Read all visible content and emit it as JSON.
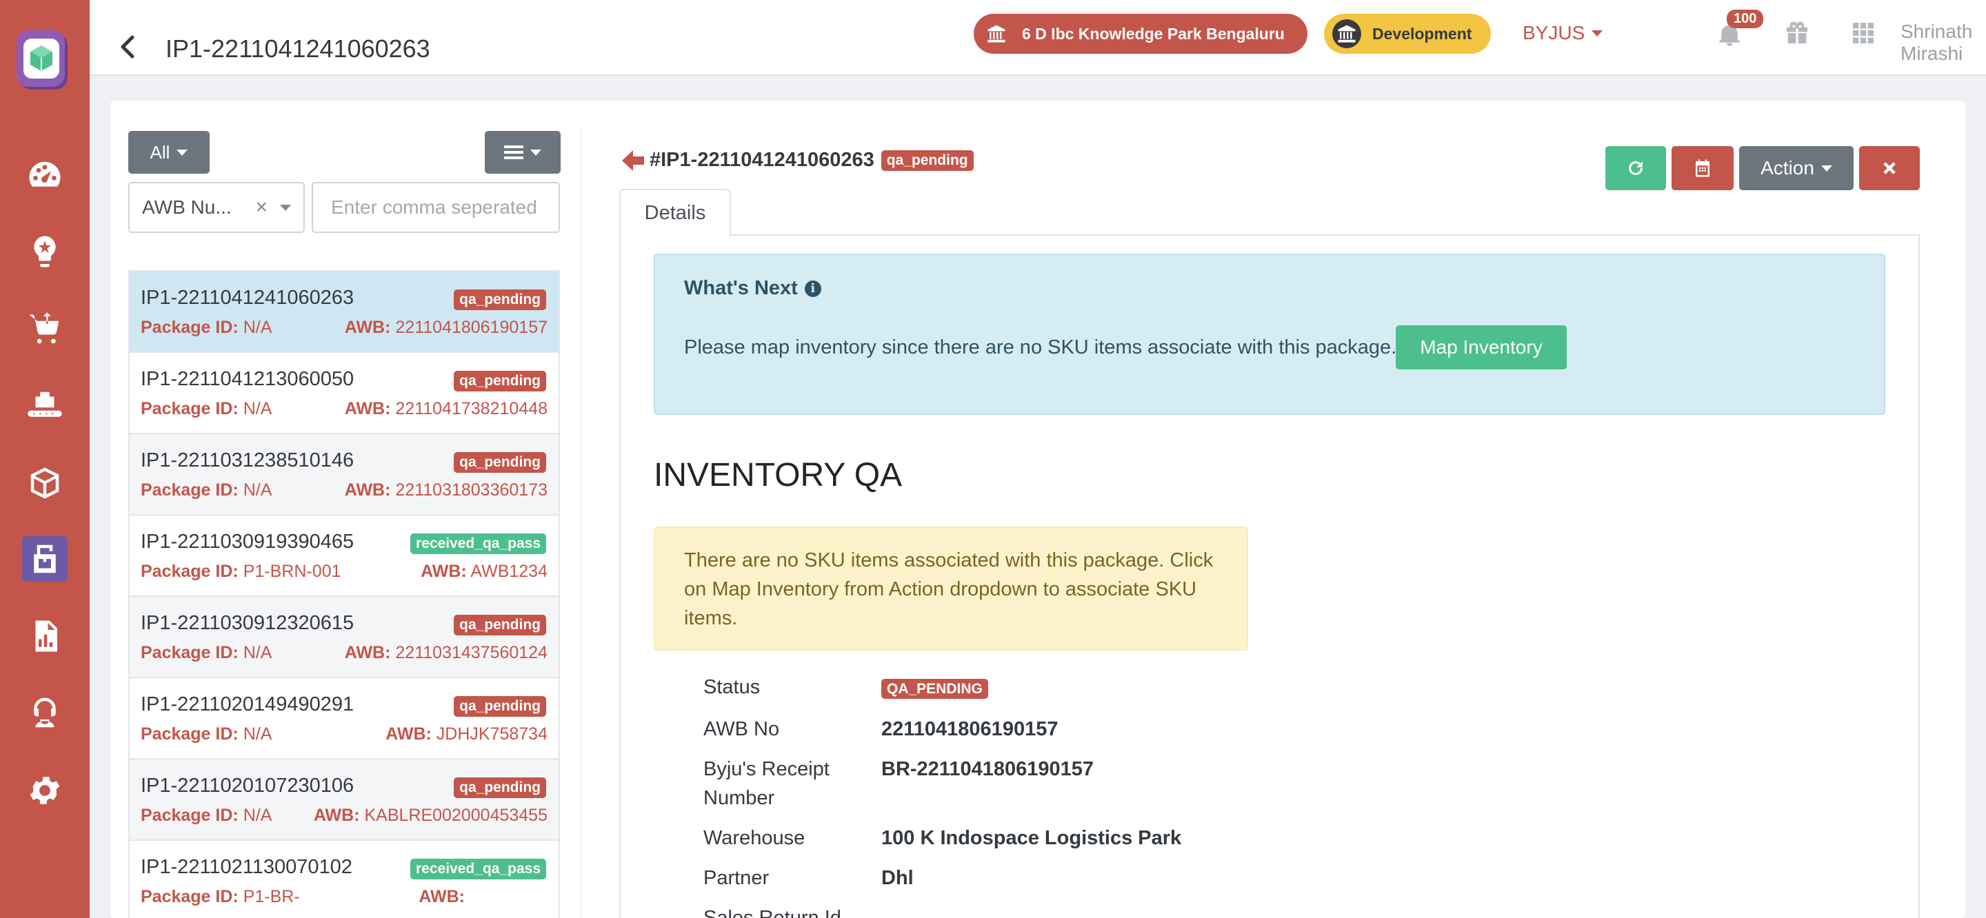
{
  "header": {
    "title": "IP1-2211041241060263",
    "warehouse": "6 D Ibc Knowledge Park Bengaluru",
    "environment": "Development",
    "company": "BYJUS",
    "notification_count": "100",
    "user_name": "Shrinath Mirashi"
  },
  "colors": {
    "rail": "#c4554a",
    "danger": "#c4554a",
    "success": "#4cbf8c",
    "secondary": "#6c757d",
    "info_bg": "#d6ecf3",
    "warning_bg": "#fcf3cd",
    "env": "#f4c542"
  },
  "sidebar": {
    "items": [
      {
        "icon": "dashboard-icon"
      },
      {
        "icon": "lightbulb-icon"
      },
      {
        "icon": "cart-icon"
      },
      {
        "icon": "conveyor-icon"
      },
      {
        "icon": "box-icon"
      },
      {
        "icon": "returns-icon",
        "active": true
      },
      {
        "icon": "report-icon"
      },
      {
        "icon": "support-icon"
      },
      {
        "icon": "settings-icon"
      }
    ]
  },
  "filters": {
    "all_label": "All",
    "field_value": "AWB Nu...",
    "search_placeholder": "Enter comma seperated"
  },
  "list": {
    "package_label": "Package ID:",
    "awb_label": "AWB:",
    "items": [
      {
        "id": "IP1-2211041241060263",
        "status": "qa_pending",
        "package_id": "N/A",
        "awb": "2211041806190157"
      },
      {
        "id": "IP1-2211041213060050",
        "status": "qa_pending",
        "package_id": "N/A",
        "awb": "2211041738210448"
      },
      {
        "id": "IP1-2211031238510146",
        "status": "qa_pending",
        "package_id": "N/A",
        "awb": "2211031803360173"
      },
      {
        "id": "IP1-2211030919390465",
        "status": "received_qa_pass",
        "package_id": "P1-BRN-001",
        "awb": "AWB1234"
      },
      {
        "id": "IP1-2211030912320615",
        "status": "qa_pending",
        "package_id": "N/A",
        "awb": "2211031437560124"
      },
      {
        "id": "IP1-2211020149490291",
        "status": "qa_pending",
        "package_id": "N/A",
        "awb": "JDHJK758734"
      },
      {
        "id": "IP1-2211020107230106",
        "status": "qa_pending",
        "package_id": "N/A",
        "awb": "KABLRE002000453455"
      },
      {
        "id": "IP1-2211021130070102",
        "status": "received_qa_pass",
        "package_id": "P1-BR-",
        "awb": ""
      }
    ]
  },
  "detail": {
    "title": "#IP1-2211041241060263",
    "status_tag": "qa_pending",
    "action_label": "Action",
    "tab_details": "Details",
    "whats_next_title": "What's Next",
    "whats_next_text": "Please map inventory since there are no SKU items associate with this package.",
    "map_inventory_label": "Map Inventory",
    "qa_heading": "INVENTORY QA",
    "warning_text": "There are no SKU items associated with this package. Click on Map Inventory from Action dropdown to associate SKU items.",
    "fields": {
      "status_label": "Status",
      "status_value": "QA_PENDING",
      "awb_label": "AWB No",
      "awb_value": "2211041806190157",
      "receipt_label": "Byju's Receipt Number",
      "receipt_value": "BR-2211041806190157",
      "warehouse_label": "Warehouse",
      "warehouse_value": "100 K Indospace Logistics Park",
      "partner_label": "Partner",
      "partner_value": "Dhl",
      "sales_return_label": "Sales Return Id"
    }
  }
}
